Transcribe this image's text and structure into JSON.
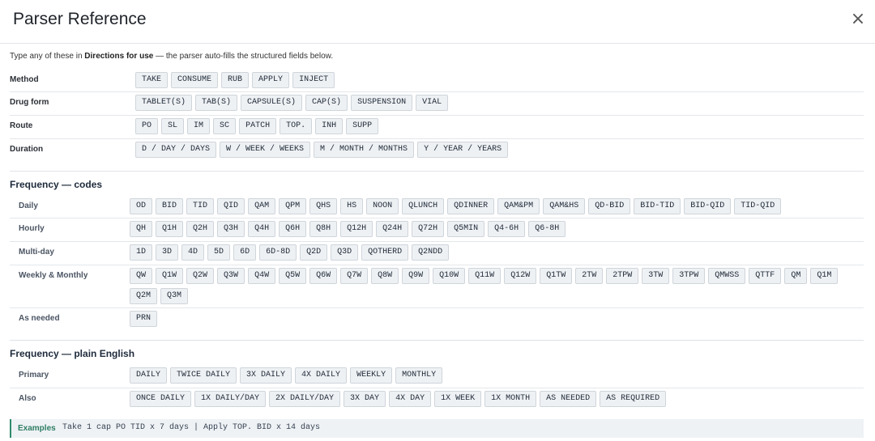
{
  "header": {
    "title": "Parser Reference",
    "close_symbol": "×"
  },
  "intro": {
    "prefix": "Type any of these in",
    "field": "Directions for use",
    "suffix": "— the parser auto-fills the structured fields below."
  },
  "structure": [
    {
      "label": "Method",
      "chips": [
        "TAKE",
        "CONSUME",
        "RUB",
        "APPLY",
        "INJECT"
      ]
    },
    {
      "label": "Drug form",
      "chips": [
        "TABLET(S)",
        "TAB(S)",
        "CAPSULE(S)",
        "CAP(S)",
        "SUSPENSION",
        "VIAL"
      ]
    },
    {
      "label": "Route",
      "chips": [
        "PO",
        "SL",
        "IM",
        "SC",
        "PATCH",
        "TOP.",
        "INH",
        "SUPP"
      ]
    },
    {
      "label": "Duration",
      "chips": [
        "D / DAY / DAYS",
        "W / WEEK / WEEKS",
        "M / MONTH / MONTHS",
        "Y / YEAR / YEARS"
      ]
    }
  ],
  "freq_codes": {
    "title": "Frequency — codes",
    "rows": [
      {
        "label": "Daily",
        "chips": [
          "OD",
          "BID",
          "TID",
          "QID",
          "QAM",
          "QPM",
          "QHS",
          "HS",
          "NOON",
          "QLUNCH",
          "QDINNER",
          "QAM&PM",
          "QAM&HS",
          "QD-BID",
          "BID-TID",
          "BID-QID",
          "TID-QID"
        ]
      },
      {
        "label": "Hourly",
        "chips": [
          "QH",
          "Q1H",
          "Q2H",
          "Q3H",
          "Q4H",
          "Q6H",
          "Q8H",
          "Q12H",
          "Q24H",
          "Q72H",
          "Q5MIN",
          "Q4-6H",
          "Q6-8H"
        ]
      },
      {
        "label": "Multi-day",
        "chips": [
          "1D",
          "3D",
          "4D",
          "5D",
          "6D",
          "6D-8D",
          "Q2D",
          "Q3D",
          "QOTHERD",
          "Q2NDD"
        ]
      },
      {
        "label": "Weekly & Monthly",
        "chips": [
          "QW",
          "Q1W",
          "Q2W",
          "Q3W",
          "Q4W",
          "Q5W",
          "Q6W",
          "Q7W",
          "Q8W",
          "Q9W",
          "Q10W",
          "Q11W",
          "Q12W",
          "Q1TW",
          "2TW",
          "2TPW",
          "3TW",
          "3TPW",
          "QMWSS",
          "QTTF",
          "QM",
          "Q1M",
          "Q2M",
          "Q3M"
        ]
      },
      {
        "label": "As needed",
        "chips": [
          "PRN"
        ]
      }
    ]
  },
  "freq_english": {
    "title": "Frequency — plain English",
    "rows": [
      {
        "label": "Primary",
        "chips": [
          "DAILY",
          "TWICE DAILY",
          "3X DAILY",
          "4X DAILY",
          "WEEKLY",
          "MONTHLY"
        ]
      },
      {
        "label": "Also",
        "chips": [
          "ONCE DAILY",
          "1X DAILY/DAY",
          "2X DAILY/DAY",
          "3X DAY",
          "4X DAY",
          "1X WEEK",
          "1X MONTH",
          "AS NEEDED",
          "AS REQUIRED"
        ]
      }
    ]
  },
  "examples": {
    "label": "Examples",
    "text": "Take 1 cap PO TID x 7 days | Apply TOP. BID x 14 days"
  }
}
